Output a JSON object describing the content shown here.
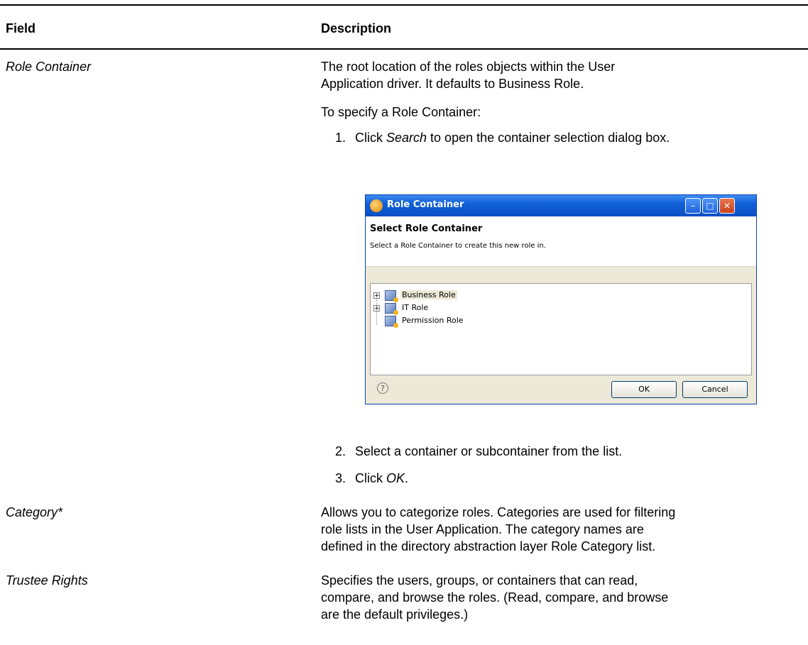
{
  "table": {
    "header_field": "Field",
    "header_description": "Description"
  },
  "rows": {
    "role_container": {
      "field": "Role Container",
      "desc_line1": "The root location of the roles objects within the User",
      "desc_line2": "Application driver. It defaults to Business Role.",
      "intro": "To specify a Role Container:",
      "step1_num": "1.",
      "step1_pre": "Click ",
      "step1_em": "Search",
      "step1_post": " to open the container selection dialog box.",
      "step2_num": "2.",
      "step2_text": "Select a container or subcontainer from the list.",
      "step3_num": "3.",
      "step3_pre": "Click ",
      "step3_em": "OK",
      "step3_post": "."
    },
    "category": {
      "field": "Category*",
      "desc_line1": "Allows you to categorize roles. Categories are used for filtering",
      "desc_line2": "role lists in the User Application. The category names are",
      "desc_line3": "defined in the directory abstraction layer Role Category list."
    },
    "trustee": {
      "field": "Trustee Rights",
      "desc_line1": "Specifies the users, groups, or containers that can read,",
      "desc_line2": "compare, and browse the roles. (Read, compare, and browse",
      "desc_line3": "are the default privileges.)"
    }
  },
  "dialog": {
    "title": "Role Container",
    "heading": "Select Role Container",
    "subtext": "Select a Role Container to create this new role in.",
    "tree_items": [
      "Business Role",
      "IT Role",
      "Permission Role"
    ],
    "selected_item": "Business Role",
    "ok_label": "OK",
    "cancel_label": "Cancel",
    "help_glyph": "?",
    "icons": [
      "app-icon",
      "minimize-icon",
      "maximize-icon",
      "close-icon",
      "role-icon",
      "help-icon"
    ]
  }
}
